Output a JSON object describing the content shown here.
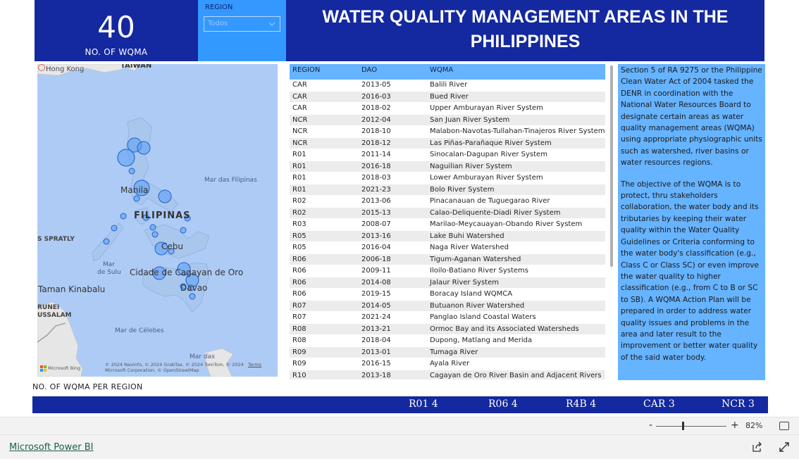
{
  "kpi": {
    "value": "40",
    "label": "NO. OF  WQMA"
  },
  "slicer": {
    "label": "REGION",
    "value": "Todos"
  },
  "title": {
    "line1": "WATER QUALITY MANAGEMENT AREAS IN THE",
    "line2": "PHILIPPINES"
  },
  "map": {
    "labels": {
      "hong_kong": "Hong Kong",
      "taiwan": "TAIWAN",
      "mar_filipinas": "Mar das Filipinas",
      "manila": "Manila",
      "filipinas": "FILIPINAS",
      "spratly": "S SPRATLY",
      "cebu": "Cebu",
      "mar_de_sulu_1": "Mar",
      "mar_de_sulu_2": "de Sulu",
      "cagayan": "Cidade de Cagayan de Oro",
      "davao": "Davao",
      "kinabalu": "Taman Kinabalu",
      "brunei_1": "RUNEI",
      "brunei_2": "USSALAM",
      "celebes": "Mar de Célebes",
      "mar_das": "Mar das",
      "attribution": "© 2024 Navinfo, © 2024 GrabTax, © 2024 TomTom, © 2024 Microsoft Corporation, © OpenStreetMap",
      "terms": "Terms",
      "bing": "Microsoft Bing"
    }
  },
  "table": {
    "headers": {
      "region": "REGION",
      "dao": "DAO",
      "wqma": "WQMA"
    },
    "rows": [
      [
        "CAR",
        "2013-05",
        "Balili River"
      ],
      [
        "CAR",
        "2016-03",
        "Bued River"
      ],
      [
        "CAR",
        "2018-02",
        "Upper Amburayan River System"
      ],
      [
        "NCR",
        "2012-04",
        "San Juan River System"
      ],
      [
        "NCR",
        "2018-10",
        "Malabon-Navotas-Tullahan-Tinajeros River System"
      ],
      [
        "NCR",
        "2018-12",
        "Las Piñas-Parañaque River System"
      ],
      [
        "R01",
        "2011-14",
        "Sinocalan-Dagupan River System"
      ],
      [
        "R01",
        "2016-18",
        "Naguilian River System"
      ],
      [
        "R01",
        "2018-03",
        "Lower Amburayan River System"
      ],
      [
        "R01",
        "2021-23",
        "Bolo River System"
      ],
      [
        "R02",
        "2013-06",
        "Pinacanauan de Tuguegarao River"
      ],
      [
        "R02",
        "2015-13",
        "Calao-Deliquente-Diadi River System"
      ],
      [
        "R03",
        "2008-07",
        "Marilao-Meycauayan-Obando River System"
      ],
      [
        "R05",
        "2013-16",
        "Lake Buhi Watershed"
      ],
      [
        "R05",
        "2016-04",
        "Naga River Watershed"
      ],
      [
        "R06",
        "2006-18",
        "Tigum-Aganan Watershed"
      ],
      [
        "R06",
        "2009-11",
        "Iloilo-Batiano River Systems"
      ],
      [
        "R06",
        "2014-08",
        "Jalaur River System"
      ],
      [
        "R06",
        "2019-15",
        "Boracay Island WQMCA"
      ],
      [
        "R07",
        "2014-05",
        "Butuanon River Watershed"
      ],
      [
        "R07",
        "2021-24",
        "Panglao Island Coastal Waters"
      ],
      [
        "R08",
        "2013-21",
        "Ormoc Bay and its Associated Watersheds"
      ],
      [
        "R08",
        "2018-04",
        "Dupong, Matlang and Merida"
      ],
      [
        "R09",
        "2013-01",
        "Tumaga River"
      ],
      [
        "R09",
        "2016-15",
        "Ayala River"
      ],
      [
        "R10",
        "2013-18",
        "Cagayan de Oro River Basin and Adjacent Rivers"
      ]
    ]
  },
  "description": {
    "p1": "Section 5 of RA 9275 or the Philippine Clean Water Act of 2004 tasked the DENR in coordination with the National Water Resources Board to designate certain areas as water quality management areas (WQMA) using appropriate physiographic units such as watershed, river basins or water resources regions.",
    "p2": "The objective of the WQMA is to protect, thru stakeholders collaboration, the water body and its tributaries by keeping their water quality within the Water Quality Guidelines or Criteria conforming to the water body's classification (e.g., Class C or Class SC) or even improve the water quality to higher classification (e.g., from C to B or SC to SB). A WQMA Action Plan will be prepared in order to address water quality issues and problems in the area and later result to the improvement or better water quality of the said water body."
  },
  "subtitle": "NO. OF WQMA PER REGION",
  "ticker": {
    "items": [
      "R01  4",
      "R06  4",
      "R4B  4",
      "CAR   3",
      "NCR   3"
    ]
  },
  "zoom": {
    "minus": "-",
    "plus": "+",
    "value": "82%"
  },
  "footer": {
    "brand": "Microsoft Power BI"
  }
}
